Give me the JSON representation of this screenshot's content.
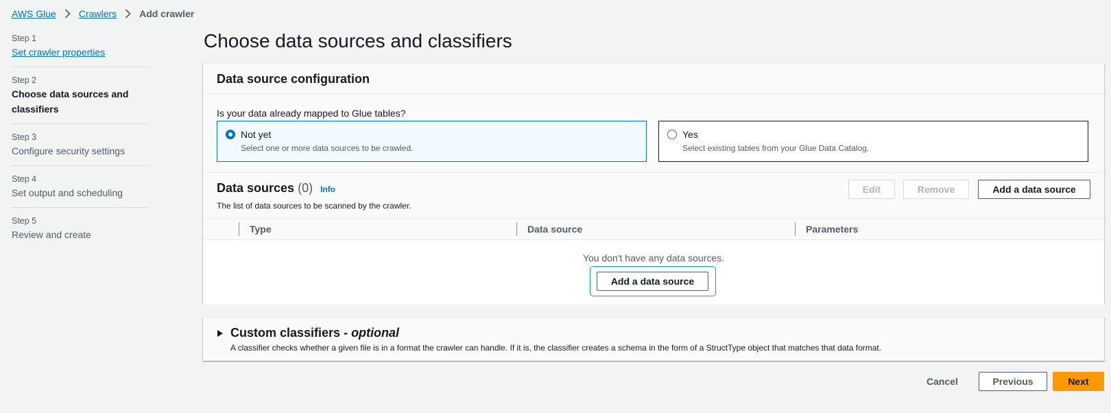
{
  "breadcrumb": {
    "items": [
      "AWS Glue",
      "Crawlers"
    ],
    "current": "Add crawler"
  },
  "steps": [
    {
      "num": "Step 1",
      "title": "Set crawler properties",
      "state": "link"
    },
    {
      "num": "Step 2",
      "title": "Choose data sources and classifiers",
      "state": "active"
    },
    {
      "num": "Step 3",
      "title": "Configure security settings",
      "state": "pending"
    },
    {
      "num": "Step 4",
      "title": "Set output and scheduling",
      "state": "pending"
    },
    {
      "num": "Step 5",
      "title": "Review and create",
      "state": "pending"
    }
  ],
  "page_title": "Choose data sources and classifiers",
  "config": {
    "header": "Data source configuration",
    "question": "Is your data already mapped to Glue tables?",
    "options": [
      {
        "label": "Not yet",
        "desc": "Select one or more data sources to be crawled.",
        "selected": true
      },
      {
        "label": "Yes",
        "desc": "Select existing tables from your Glue Data Catalog.",
        "selected": false
      }
    ]
  },
  "data_sources": {
    "title": "Data sources",
    "count": "(0)",
    "info": "Info",
    "desc": "The list of data sources to be scanned by the crawler.",
    "edit_label": "Edit",
    "remove_label": "Remove",
    "add_label": "Add a data source",
    "columns": [
      "Type",
      "Data source",
      "Parameters"
    ],
    "empty_text": "You don't have any data sources.",
    "empty_add_label": "Add a data source"
  },
  "classifiers": {
    "title": "Custom classifiers -",
    "optional": "optional",
    "desc": "A classifier checks whether a given file is in a format the crawler can handle. If it is, the classifier creates a schema in the form of a StructType object that matches that data format."
  },
  "footer": {
    "cancel_label": "Cancel",
    "previous_label": "Previous",
    "next_label": "Next"
  },
  "colors": {
    "link": "#0073bb",
    "primary": "#ff9900",
    "focus": "#00a1c9"
  }
}
